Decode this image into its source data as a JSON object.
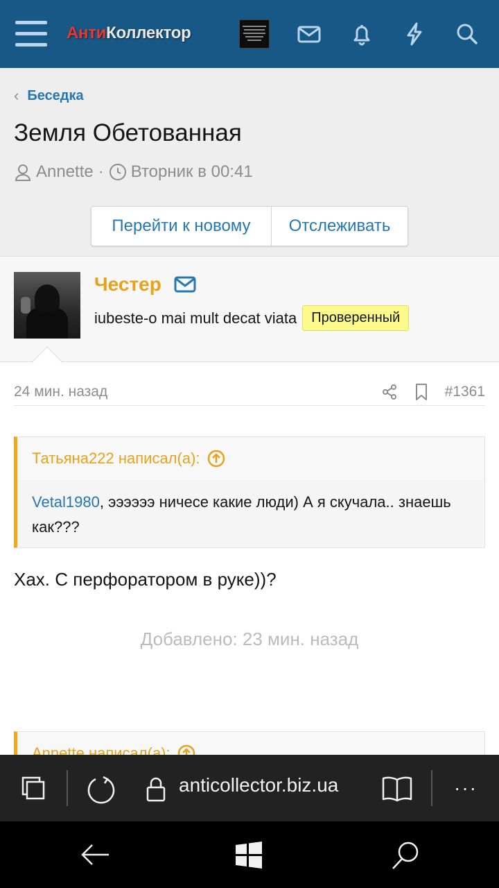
{
  "header": {
    "logo_part1": "Анти",
    "logo_part2": "Коллектор",
    "icons": [
      "menu-icon",
      "mail-icon",
      "bell-icon",
      "bolt-icon",
      "search-icon"
    ]
  },
  "breadcrumb": {
    "label": "Беседка"
  },
  "thread": {
    "title": "Земля Обетованная",
    "author": "Annette",
    "separator": "·",
    "date": "Вторник в 00:41",
    "btn_new": "Перейти к новому",
    "btn_watch": "Отслеживать"
  },
  "user": {
    "name": "Честер",
    "tagline": "iubeste-o mai mult decat viata",
    "badge": "Проверенный"
  },
  "post": {
    "time": "24 мин. назад",
    "number": "#1361",
    "quote_author": "Татьяна222 написал(а):",
    "quote_link": "Vetal1980",
    "quote_text": ", ээээээ ничесе какие люди) А я скучала.. знаешь как???",
    "message": "Хах. С перфоратором в руке))?",
    "added": "Добавлено: 23 мин. назад",
    "quote2_author": "Annette написал(а):"
  },
  "browser": {
    "url": "anticollector.biz.ua",
    "more": "···"
  },
  "colors": {
    "header_bg": "#185886",
    "link": "#2577b1",
    "accent_orange": "#e8a21a",
    "badge_bg": "#fdfa8c"
  }
}
